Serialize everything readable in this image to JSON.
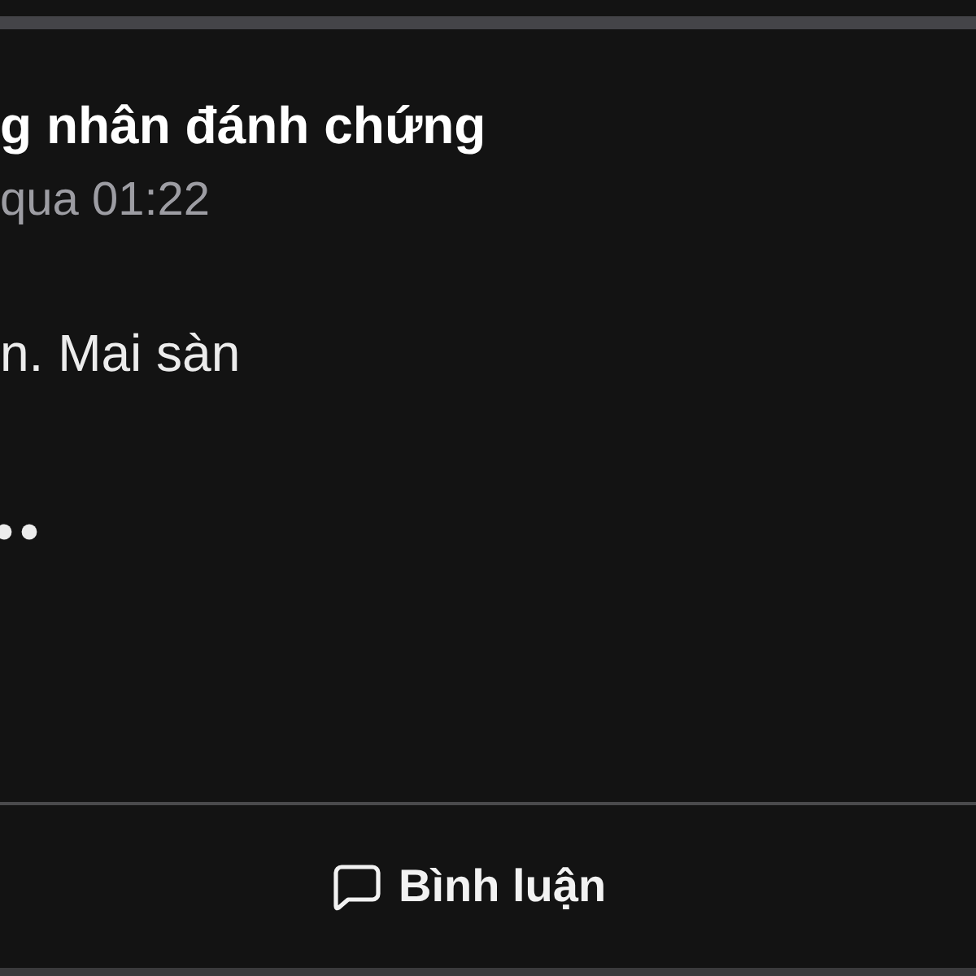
{
  "post": {
    "title": "g nhân đánh chứng",
    "time": "qua 01:22",
    "body": "n. Mai sàn",
    "truncated": true
  },
  "actions": [
    {
      "kind": "comment",
      "label": "Bình luận"
    }
  ]
}
